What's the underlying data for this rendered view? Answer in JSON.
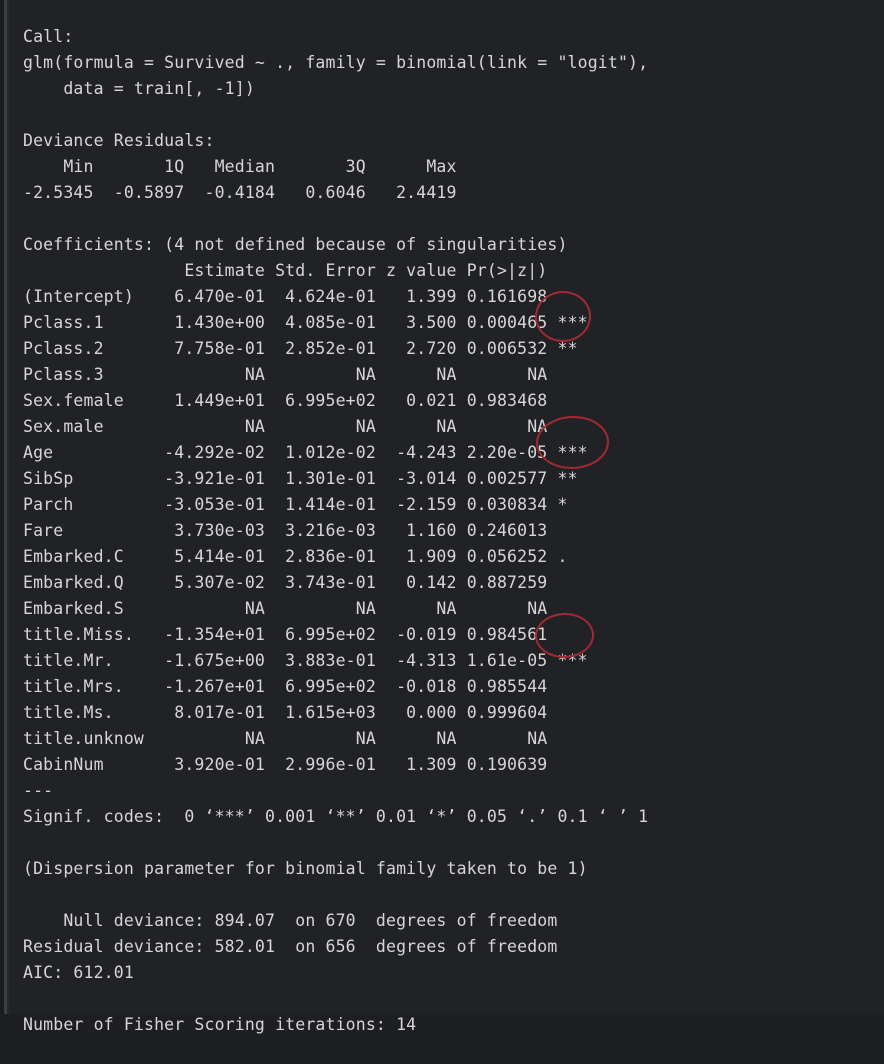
{
  "theme": {
    "background": "#212225",
    "text_color": "#d6d6d6",
    "annotation_color": "#a02b32",
    "gutter_color": "#3c3f41"
  },
  "console": {
    "lines": [
      "Call:",
      "glm(formula = Survived ~ ., family = binomial(link = \"logit\"),",
      "    data = train[, -1])",
      "",
      "Deviance Residuals:",
      "    Min       1Q   Median       3Q      Max  ",
      "-2.5345  -0.5897  -0.4184   0.6046   2.4419  ",
      "",
      "Coefficients: (4 not defined because of singularities)",
      "                Estimate Std. Error z value Pr(>|z|)    ",
      "(Intercept)    6.470e-01  4.624e-01   1.399 0.161698    ",
      "Pclass.1       1.430e+00  4.085e-01   3.500 0.000465 ***",
      "Pclass.2       7.758e-01  2.852e-01   2.720 0.006532 ** ",
      "Pclass.3              NA         NA      NA       NA    ",
      "Sex.female     1.449e+01  6.995e+02   0.021 0.983468    ",
      "Sex.male              NA         NA      NA       NA    ",
      "Age           -4.292e-02  1.012e-02  -4.243 2.20e-05 ***",
      "SibSp         -3.921e-01  1.301e-01  -3.014 0.002577 ** ",
      "Parch         -3.053e-01  1.414e-01  -2.159 0.030834 *  ",
      "Fare           3.730e-03  3.216e-03   1.160 0.246013    ",
      "Embarked.C     5.414e-01  2.836e-01   1.909 0.056252 .  ",
      "Embarked.Q     5.307e-02  3.743e-01   0.142 0.887259    ",
      "Embarked.S            NA         NA      NA       NA    ",
      "title.Miss.   -1.354e+01  6.995e+02  -0.019 0.984561    ",
      "title.Mr.     -1.675e+00  3.883e-01  -4.313 1.61e-05 ***",
      "title.Mrs.    -1.267e+01  6.995e+02  -0.018 0.985544    ",
      "title.Ms.      8.017e-01  1.615e+03   0.000 0.999604    ",
      "title.unknow          NA         NA      NA       NA    ",
      "CabinNum       3.920e-01  2.996e-01   1.309 0.190639    ",
      "---",
      "Signif. codes:  0 ‘***’ 0.001 ‘**’ 0.01 ‘*’ 0.05 ‘.’ 0.1 ‘ ’ 1",
      "",
      "(Dispersion parameter for binomial family taken to be 1)",
      "",
      "    Null deviance: 894.07  on 670  degrees of freedom",
      "Residual deviance: 582.01  on 656  degrees of freedom",
      "AIC: 612.01",
      "",
      "Number of Fisher Scoring iterations: 14",
      ""
    ],
    "call": {
      "label": "Call:",
      "formula": "glm(formula = Survived ~ ., family = binomial(link = \"logit\"),",
      "data_arg": "    data = train[, -1])"
    },
    "deviance_residuals": {
      "label": "Deviance Residuals:",
      "headers": [
        "Min",
        "1Q",
        "Median",
        "3Q",
        "Max"
      ],
      "values": [
        "-2.5345",
        "-0.5897",
        "-0.4184",
        "0.6046",
        "2.4419"
      ]
    },
    "coefficients": {
      "label": "Coefficients: (4 not defined because of singularities)",
      "headers": [
        "",
        "Estimate",
        "Std. Error",
        "z value",
        "Pr(>|z|)",
        ""
      ],
      "rows": [
        {
          "term": "(Intercept)",
          "estimate": "6.470e-01",
          "std_error": "4.624e-01",
          "z_value": "1.399",
          "p_value": "0.161698",
          "signif": ""
        },
        {
          "term": "Pclass.1",
          "estimate": "1.430e+00",
          "std_error": "4.085e-01",
          "z_value": "3.500",
          "p_value": "0.000465",
          "signif": "***"
        },
        {
          "term": "Pclass.2",
          "estimate": "7.758e-01",
          "std_error": "2.852e-01",
          "z_value": "2.720",
          "p_value": "0.006532",
          "signif": "**"
        },
        {
          "term": "Pclass.3",
          "estimate": "NA",
          "std_error": "NA",
          "z_value": "NA",
          "p_value": "NA",
          "signif": ""
        },
        {
          "term": "Sex.female",
          "estimate": "1.449e+01",
          "std_error": "6.995e+02",
          "z_value": "0.021",
          "p_value": "0.983468",
          "signif": ""
        },
        {
          "term": "Sex.male",
          "estimate": "NA",
          "std_error": "NA",
          "z_value": "NA",
          "p_value": "NA",
          "signif": ""
        },
        {
          "term": "Age",
          "estimate": "-4.292e-02",
          "std_error": "1.012e-02",
          "z_value": "-4.243",
          "p_value": "2.20e-05",
          "signif": "***"
        },
        {
          "term": "SibSp",
          "estimate": "-3.921e-01",
          "std_error": "1.301e-01",
          "z_value": "-3.014",
          "p_value": "0.002577",
          "signif": "**"
        },
        {
          "term": "Parch",
          "estimate": "-3.053e-01",
          "std_error": "1.414e-01",
          "z_value": "-2.159",
          "p_value": "0.030834",
          "signif": "*"
        },
        {
          "term": "Fare",
          "estimate": "3.730e-03",
          "std_error": "3.216e-03",
          "z_value": "1.160",
          "p_value": "0.246013",
          "signif": ""
        },
        {
          "term": "Embarked.C",
          "estimate": "5.414e-01",
          "std_error": "2.836e-01",
          "z_value": "1.909",
          "p_value": "0.056252",
          "signif": "."
        },
        {
          "term": "Embarked.Q",
          "estimate": "5.307e-02",
          "std_error": "3.743e-01",
          "z_value": "0.142",
          "p_value": "0.887259",
          "signif": ""
        },
        {
          "term": "Embarked.S",
          "estimate": "NA",
          "std_error": "NA",
          "z_value": "NA",
          "p_value": "NA",
          "signif": ""
        },
        {
          "term": "title.Miss.",
          "estimate": "-1.354e+01",
          "std_error": "6.995e+02",
          "z_value": "-0.019",
          "p_value": "0.984561",
          "signif": ""
        },
        {
          "term": "title.Mr.",
          "estimate": "-1.675e+00",
          "std_error": "3.883e-01",
          "z_value": "-4.313",
          "p_value": "1.61e-05",
          "signif": "***"
        },
        {
          "term": "title.Mrs.",
          "estimate": "-1.267e+01",
          "std_error": "6.995e+02",
          "z_value": "-0.018",
          "p_value": "0.985544",
          "signif": ""
        },
        {
          "term": "title.Ms.",
          "estimate": "8.017e-01",
          "std_error": "1.615e+03",
          "z_value": "0.000",
          "p_value": "0.999604",
          "signif": ""
        },
        {
          "term": "title.unknow",
          "estimate": "NA",
          "std_error": "NA",
          "z_value": "NA",
          "p_value": "NA",
          "signif": ""
        },
        {
          "term": "CabinNum",
          "estimate": "3.920e-01",
          "std_error": "2.996e-01",
          "z_value": "1.309",
          "p_value": "0.190639",
          "signif": ""
        }
      ]
    },
    "separator": "---",
    "signif_codes": "Signif. codes:  0 ‘***’ 0.001 ‘**’ 0.01 ‘*’ 0.05 ‘.’ 0.1 ‘ ’ 1",
    "dispersion": "(Dispersion parameter for binomial family taken to be 1)",
    "fit": {
      "null_deviance": "    Null deviance: 894.07  on 670  degrees of freedom",
      "residual_deviance": "Residual deviance: 582.01  on 656  degrees of freedom",
      "aic": "AIC: 612.01",
      "iterations": "Number of Fisher Scoring iterations: 14",
      "null_deviance_value": "894.07",
      "null_deviance_df": "670",
      "residual_deviance_value": "582.01",
      "residual_deviance_df": "656",
      "aic_value": "612.01",
      "fisher_iterations": "14"
    }
  },
  "annotations": [
    {
      "name": "highlight-pclass-signif",
      "shape": "ellipse",
      "color": "#a02b32",
      "targets": [
        "***",
        "**"
      ]
    },
    {
      "name": "highlight-age-sibsp-signif",
      "shape": "ellipse",
      "color": "#a02b32",
      "targets": [
        "***",
        "**"
      ]
    },
    {
      "name": "highlight-title-mr-signif",
      "shape": "ellipse",
      "color": "#a02b32",
      "targets": [
        "***"
      ]
    }
  ]
}
